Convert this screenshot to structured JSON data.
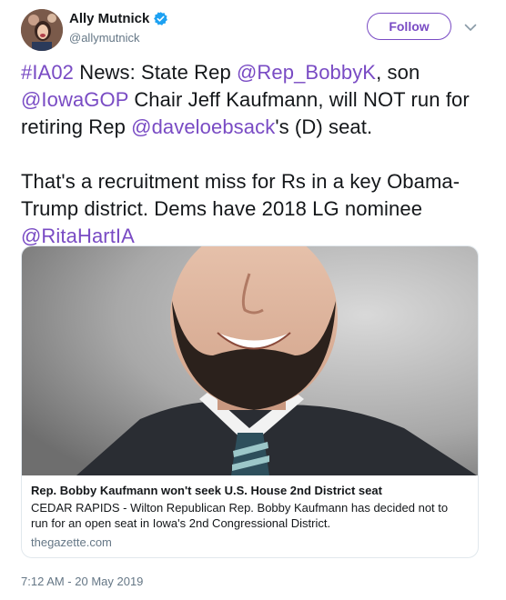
{
  "header": {
    "display_name": "Ally Mutnick",
    "handle": "@allymutnick",
    "follow_label": "Follow"
  },
  "tweet": {
    "p1": [
      {
        "text": "#IA02",
        "link": true
      },
      {
        "text": " News: State Rep ",
        "link": false
      },
      {
        "text": "@Rep_BobbyK",
        "link": true
      },
      {
        "text": ", son ",
        "link": false
      },
      {
        "text": "@IowaGOP",
        "link": true
      },
      {
        "text": " Chair Jeff Kaufmann, will NOT run for retiring Rep ",
        "link": false
      },
      {
        "text": "@daveloebsack",
        "link": true
      },
      {
        "text": "'s (D) seat.",
        "link": false
      }
    ],
    "p2": [
      {
        "text": "That's a recruitment miss for Rs in a key Obama-Trump district. Dems have 2018 LG nominee ",
        "link": false
      },
      {
        "text": "@RitaHartIA",
        "link": true
      }
    ]
  },
  "card": {
    "title": "Rep. Bobby Kaufmann won't seek U.S. House 2nd District seat",
    "description": "CEDAR RAPIDS - Wilton Republican Rep. Bobby Kaufmann has decided not to run for an open seat in Iowa's 2nd Congressional District.",
    "domain": "thegazette.com"
  },
  "timestamp": "7:12 AM - 20 May 2019",
  "colors": {
    "link": "#794bc4",
    "verified": "#1da1f2",
    "secondary_text": "#657786"
  }
}
